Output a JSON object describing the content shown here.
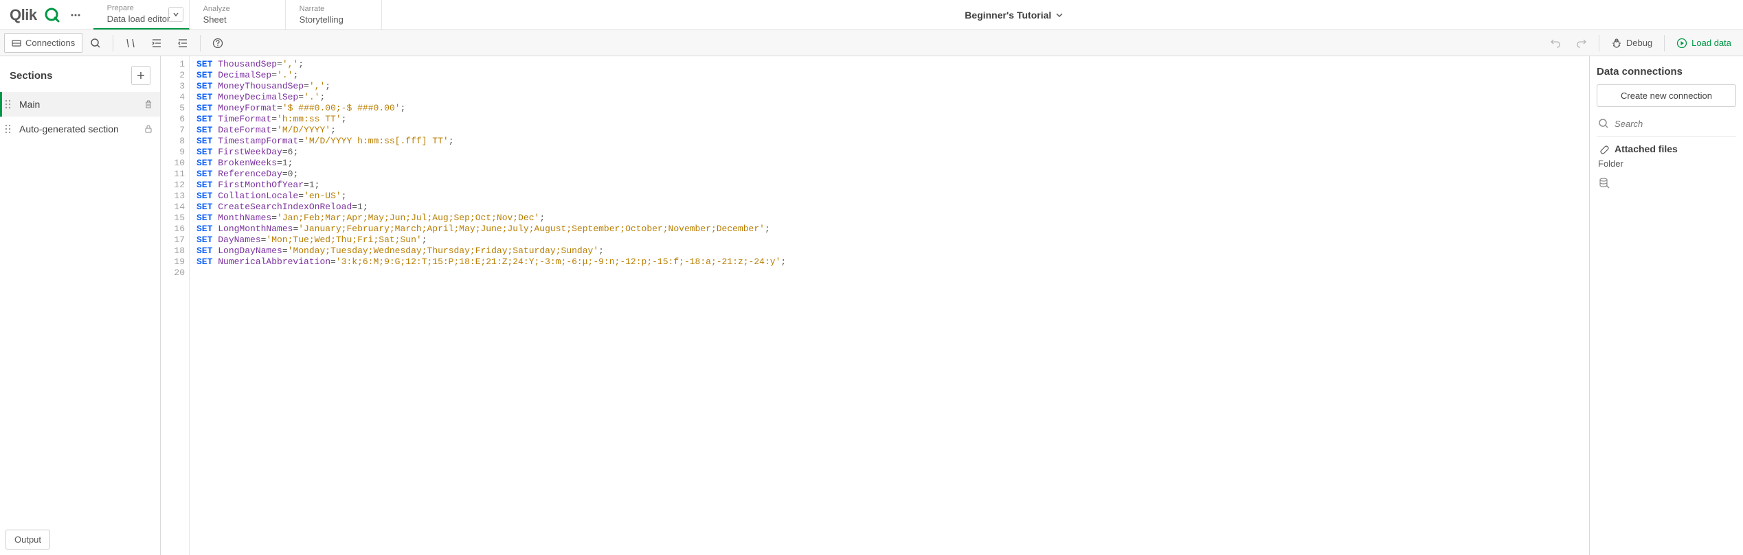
{
  "header": {
    "logo_text": "Qlik",
    "tabs": [
      {
        "top": "Prepare",
        "bottom": "Data load editor",
        "active": true,
        "has_chevron": true
      },
      {
        "top": "Analyze",
        "bottom": "Sheet",
        "active": false,
        "has_chevron": false
      },
      {
        "top": "Narrate",
        "bottom": "Storytelling",
        "active": false,
        "has_chevron": false
      }
    ],
    "app_name": "Beginner's Tutorial"
  },
  "toolbar": {
    "connections_label": "Connections",
    "debug_label": "Debug",
    "load_label": "Load data"
  },
  "left": {
    "sections_title": "Sections",
    "items": [
      {
        "label": "Main",
        "active": true,
        "right_icon": "delete"
      },
      {
        "label": "Auto-generated section",
        "active": false,
        "right_icon": "lock"
      }
    ],
    "output_label": "Output"
  },
  "code": {
    "lines": [
      [
        [
          "SET",
          "set"
        ],
        [
          " "
        ],
        [
          "ThousandSep",
          "var"
        ],
        [
          "=",
          "punct"
        ],
        [
          "','",
          "str"
        ],
        [
          ";",
          "punct"
        ]
      ],
      [
        [
          "SET",
          "set"
        ],
        [
          " "
        ],
        [
          "DecimalSep",
          "var"
        ],
        [
          "=",
          "punct"
        ],
        [
          "'.'",
          "str"
        ],
        [
          ";",
          "punct"
        ]
      ],
      [
        [
          "SET",
          "set"
        ],
        [
          " "
        ],
        [
          "MoneyThousandSep",
          "var"
        ],
        [
          "=",
          "punct"
        ],
        [
          "','",
          "str"
        ],
        [
          ";",
          "punct"
        ]
      ],
      [
        [
          "SET",
          "set"
        ],
        [
          " "
        ],
        [
          "MoneyDecimalSep",
          "var"
        ],
        [
          "=",
          "punct"
        ],
        [
          "'.'",
          "str"
        ],
        [
          ";",
          "punct"
        ]
      ],
      [
        [
          "SET",
          "set"
        ],
        [
          " "
        ],
        [
          "MoneyFormat",
          "var"
        ],
        [
          "=",
          "punct"
        ],
        [
          "'$ ###0.00;-$ ###0.00'",
          "str"
        ],
        [
          ";",
          "punct"
        ]
      ],
      [
        [
          "SET",
          "set"
        ],
        [
          " "
        ],
        [
          "TimeFormat",
          "var"
        ],
        [
          "=",
          "punct"
        ],
        [
          "'h:mm:ss TT'",
          "str"
        ],
        [
          ";",
          "punct"
        ]
      ],
      [
        [
          "SET",
          "set"
        ],
        [
          " "
        ],
        [
          "DateFormat",
          "var"
        ],
        [
          "=",
          "punct"
        ],
        [
          "'M/D/YYYY'",
          "str"
        ],
        [
          ";",
          "punct"
        ]
      ],
      [
        [
          "SET",
          "set"
        ],
        [
          " "
        ],
        [
          "TimestampFormat",
          "var"
        ],
        [
          "=",
          "punct"
        ],
        [
          "'M/D/YYYY h:mm:ss[.fff] TT'",
          "str"
        ],
        [
          ";",
          "punct"
        ]
      ],
      [
        [
          "SET",
          "set"
        ],
        [
          " "
        ],
        [
          "FirstWeekDay",
          "var"
        ],
        [
          "=",
          "punct"
        ],
        [
          "6",
          "punct"
        ],
        [
          ";",
          "punct"
        ]
      ],
      [
        [
          "SET",
          "set"
        ],
        [
          " "
        ],
        [
          "BrokenWeeks",
          "var"
        ],
        [
          "=",
          "punct"
        ],
        [
          "1",
          "punct"
        ],
        [
          ";",
          "punct"
        ]
      ],
      [
        [
          "SET",
          "set"
        ],
        [
          " "
        ],
        [
          "ReferenceDay",
          "var"
        ],
        [
          "=",
          "punct"
        ],
        [
          "0",
          "punct"
        ],
        [
          ";",
          "punct"
        ]
      ],
      [
        [
          "SET",
          "set"
        ],
        [
          " "
        ],
        [
          "FirstMonthOfYear",
          "var"
        ],
        [
          "=",
          "punct"
        ],
        [
          "1",
          "punct"
        ],
        [
          ";",
          "punct"
        ]
      ],
      [
        [
          "SET",
          "set"
        ],
        [
          " "
        ],
        [
          "CollationLocale",
          "var"
        ],
        [
          "=",
          "punct"
        ],
        [
          "'en-US'",
          "str"
        ],
        [
          ";",
          "punct"
        ]
      ],
      [
        [
          "SET",
          "set"
        ],
        [
          " "
        ],
        [
          "CreateSearchIndexOnReload",
          "var"
        ],
        [
          "=",
          "punct"
        ],
        [
          "1",
          "punct"
        ],
        [
          ";",
          "punct"
        ]
      ],
      [
        [
          "SET",
          "set"
        ],
        [
          " "
        ],
        [
          "MonthNames",
          "var"
        ],
        [
          "=",
          "punct"
        ],
        [
          "'Jan;Feb;Mar;Apr;May;Jun;Jul;Aug;Sep;Oct;Nov;Dec'",
          "str"
        ],
        [
          ";",
          "punct"
        ]
      ],
      [
        [
          "SET",
          "set"
        ],
        [
          " "
        ],
        [
          "LongMonthNames",
          "var"
        ],
        [
          "=",
          "punct"
        ],
        [
          "'January;February;March;April;May;June;July;August;September;October;November;December'",
          "str"
        ],
        [
          ";",
          "punct"
        ]
      ],
      [
        [
          "SET",
          "set"
        ],
        [
          " "
        ],
        [
          "DayNames",
          "var"
        ],
        [
          "=",
          "punct"
        ],
        [
          "'Mon;Tue;Wed;Thu;Fri;Sat;Sun'",
          "str"
        ],
        [
          ";",
          "punct"
        ]
      ],
      [
        [
          "SET",
          "set"
        ],
        [
          " "
        ],
        [
          "LongDayNames",
          "var"
        ],
        [
          "=",
          "punct"
        ],
        [
          "'Monday;Tuesday;Wednesday;Thursday;Friday;Saturday;Sunday'",
          "str"
        ],
        [
          ";",
          "punct"
        ]
      ],
      [
        [
          "SET",
          "set"
        ],
        [
          " "
        ],
        [
          "NumericalAbbreviation",
          "var"
        ],
        [
          "=",
          "punct"
        ],
        [
          "'3:k;6:M;9:G;12:T;15:P;18:E;21:Z;24:Y;-3:m;-6:μ;-9:n;-12:p;-15:f;-18:a;-21:z;-24:y'",
          "str"
        ],
        [
          ";",
          "punct"
        ]
      ],
      []
    ]
  },
  "right": {
    "title": "Data connections",
    "create_label": "Create new connection",
    "search_placeholder": "Search",
    "attached_label": "Attached files",
    "folder_label": "Folder"
  }
}
